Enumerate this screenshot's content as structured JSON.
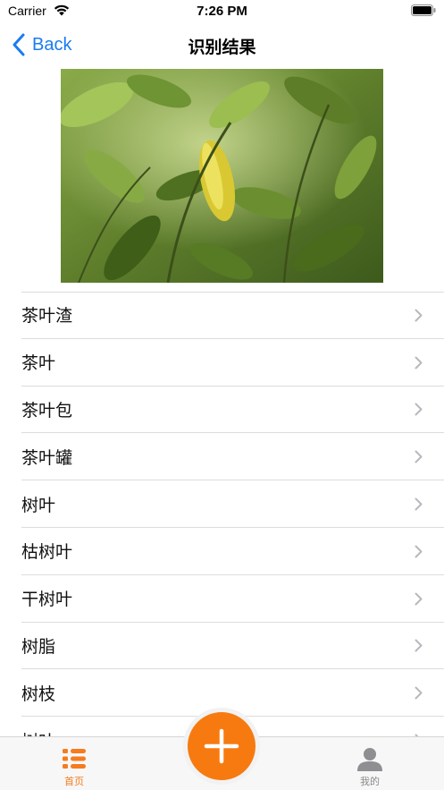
{
  "status_bar": {
    "carrier": "Carrier",
    "time": "7:26 PM",
    "icons": [
      "wifi-icon",
      "battery-icon"
    ]
  },
  "nav": {
    "back_label": "Back",
    "title": "识别结果",
    "accent_color": "#1a7cf0"
  },
  "photo": {
    "subject": "tea-leaves-photo"
  },
  "results": {
    "items": [
      {
        "label": "茶叶渣"
      },
      {
        "label": "茶叶"
      },
      {
        "label": "茶叶包"
      },
      {
        "label": "茶叶罐"
      },
      {
        "label": "树叶"
      },
      {
        "label": "枯树叶"
      },
      {
        "label": "干树叶"
      },
      {
        "label": "树脂"
      },
      {
        "label": "树枝"
      },
      {
        "label": "树叶"
      }
    ]
  },
  "tab_bar": {
    "home_label": "首页",
    "me_label": "我的",
    "active_color": "#f57c1f",
    "inactive_color": "#8a8a8a",
    "fab_color": "#f77a10",
    "fab_icon": "plus-icon"
  }
}
